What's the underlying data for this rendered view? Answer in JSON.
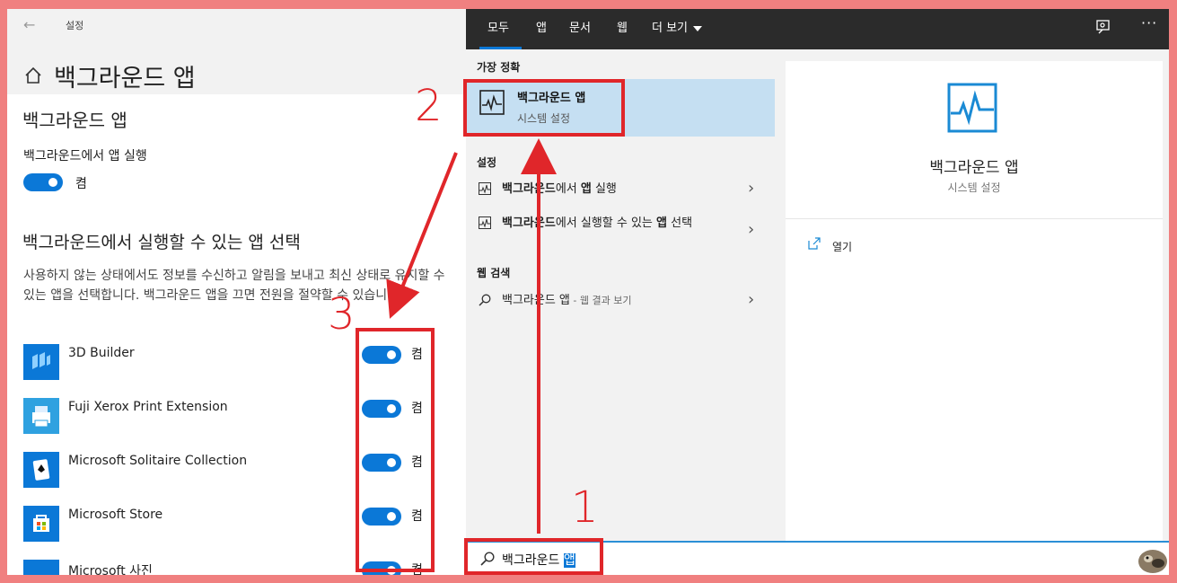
{
  "settings": {
    "window_title": "설정",
    "page_title": "백그라운드 앱",
    "section_title": "백그라운드 앱",
    "run_label": "백그라운드에서 앱 실행",
    "run_state": "켬",
    "choose_title": "백그라운드에서 실행할 수 있는 앱 선택",
    "description": "사용하지 않는 상태에서도 정보를 수신하고 알림을 보내고 최신 상태로 유지할 수 있는 앱을 선택합니다. 백그라운드 앱을 끄면 전원을 절약할 수 있습니다.",
    "apps": [
      {
        "name": "3D Builder",
        "state": "켬",
        "icon": "3d-builder-icon"
      },
      {
        "name": "Fuji Xerox Print Extension",
        "state": "켬",
        "icon": "printer-icon"
      },
      {
        "name": "Microsoft Solitaire Collection",
        "state": "켬",
        "icon": "solitaire-icon"
      },
      {
        "name": "Microsoft Store",
        "state": "켬",
        "icon": "store-icon"
      },
      {
        "name": "Microsoft 사진",
        "state": "켬",
        "icon": "photos-icon"
      }
    ]
  },
  "search": {
    "tabs": [
      "모두",
      "앱",
      "문서",
      "웹",
      "더 보기"
    ],
    "best_match_header": "가장 정확",
    "best_match": {
      "title": "백그라운드 앱",
      "subtitle": "시스템 설정"
    },
    "settings_header": "설정",
    "settings_results": [
      {
        "bold": "백그라운드",
        "rest": "에서 ",
        "bold2": "앱",
        "rest2": " 실행"
      },
      {
        "bold": "백그라운드",
        "rest": "에서 실행할 수 있는 ",
        "bold2": "앱",
        "rest2": " 선택"
      }
    ],
    "web_header": "웹 검색",
    "web_result": {
      "text": "백그라운드 앱",
      "suffix": " - 웹 결과 보기"
    },
    "preview": {
      "title": "백그라운드 앱",
      "subtitle": "시스템 설정",
      "open_label": "열기"
    },
    "query_before": "백그라운드 ",
    "query_selected": "앱"
  },
  "annotations": {
    "step1": "1",
    "step2": "2",
    "step3": "3"
  },
  "colors": {
    "accent": "#0b78d7",
    "annotation": "#e0262a",
    "background": "#f08080"
  }
}
